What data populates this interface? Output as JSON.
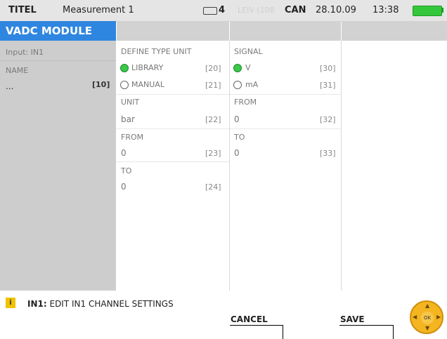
{
  "statusbar": {
    "app_name": "TITEL",
    "measurement": "Measurement 1",
    "device_count": "4",
    "faded_text": "LEIV (108",
    "can": "CAN",
    "date": "28.10.09",
    "time": "13:38"
  },
  "header": {
    "title": "VADC MODULE"
  },
  "left_panel": {
    "input_label": "Input: IN1",
    "name_label": "NAME",
    "name_value": "...",
    "name_code": "[10]"
  },
  "define_type": {
    "title": "DEFINE TYPE UNIT",
    "options": [
      {
        "label": "LIBRARY",
        "code": "[20]",
        "selected": true
      },
      {
        "label": "MANUAL",
        "code": "[21]",
        "selected": false
      }
    ],
    "unit_label": "UNIT",
    "unit_value": "bar",
    "unit_code": "[22]",
    "from_label": "FROM",
    "from_value": "0",
    "from_code": "[23]",
    "to_label": "TO",
    "to_value": "0",
    "to_code": "[24]"
  },
  "signal": {
    "title": "SIGNAL",
    "options": [
      {
        "label": "V",
        "code": "[30]",
        "selected": true
      },
      {
        "label": "mA",
        "code": "[31]",
        "selected": false
      }
    ],
    "from_label": "FROM",
    "from_value": "0",
    "from_code": "[32]",
    "to_label": "TO",
    "to_value": "0",
    "to_code": "[33]"
  },
  "footer": {
    "icon": "i",
    "channel": "IN1:",
    "message": "EDIT IN1 CHANNEL SETTINGS",
    "cancel": "CANCEL",
    "save": "SAVE",
    "ok": "OK"
  },
  "colors": {
    "header_blue": "#2f86e0",
    "radio_selected": "#3bc74a",
    "battery_green": "#34c73c",
    "dpad_orange": "#f4b520"
  }
}
